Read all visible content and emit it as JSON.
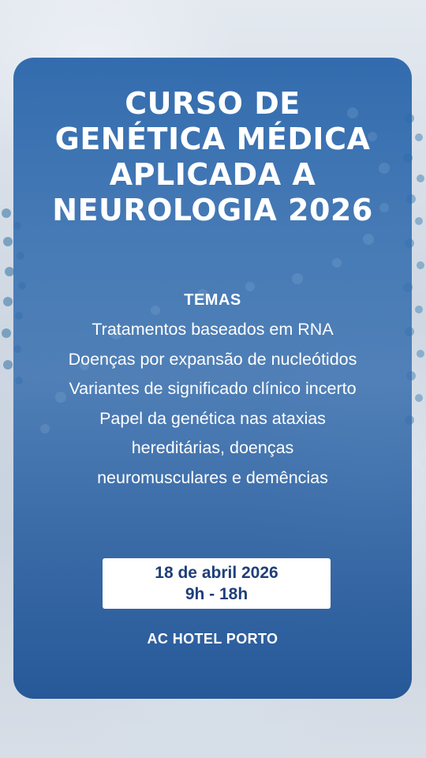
{
  "title_lines": [
    "CURSO DE",
    "GENÉTICA MÉDICA",
    "APLICADA A",
    "NEUROLOGIA 2026"
  ],
  "temas_heading": "TEMAS",
  "topics": [
    "Tratamentos baseados em RNA",
    "Doenças por expansão de nucleótidos",
    "Variantes de significado clínico incerto",
    "Papel da genética nas ataxias",
    "hereditárias, doenças",
    "neuromusculares e demências"
  ],
  "event": {
    "date": "18 de abril 2026",
    "time": "9h - 18h",
    "venue": "AC HOTEL PORTO"
  },
  "colors": {
    "card": "#2f6aae",
    "accent_text": "#1f3f7a",
    "text": "#ffffff"
  },
  "icons": [
    "dna-helix-illustration"
  ]
}
